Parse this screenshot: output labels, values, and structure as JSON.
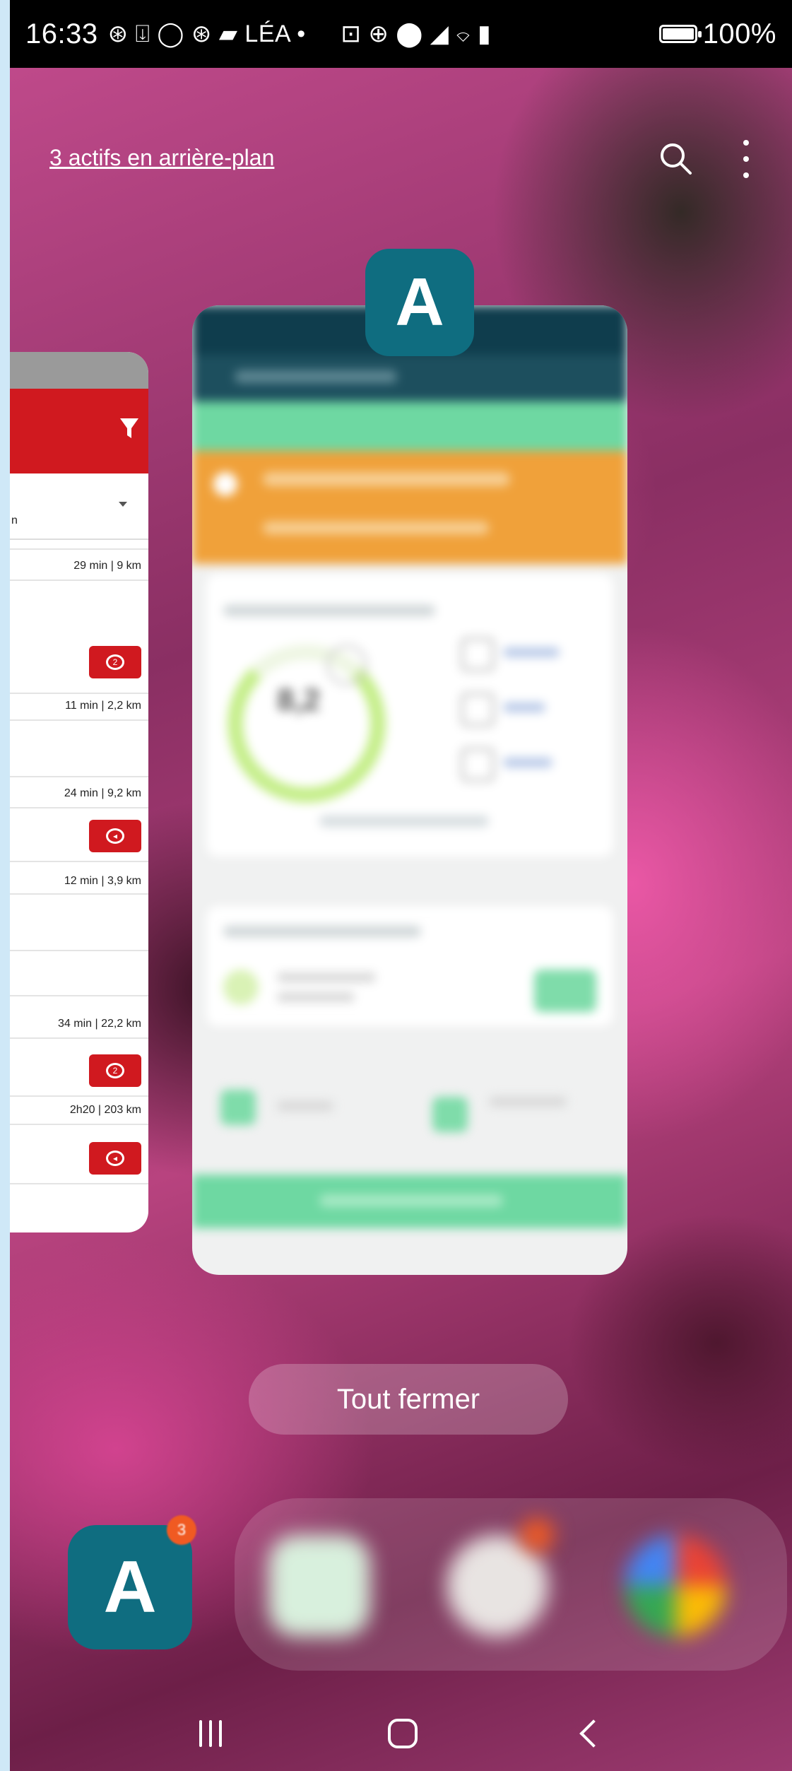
{
  "status_bar": {
    "time": "16:33",
    "notification_icons": "⊛ ⍗ ◯ ⊛ ▰ LÉA •",
    "system_icons": "⊡ ⊕ ⬤ ◢ ⌔ ▮",
    "battery": "100%",
    "battery_level": 1.0
  },
  "recents": {
    "background_apps_label": "3 actifs en arrière-plan",
    "close_all_label": "Tout fermer",
    "app_icon_letter": "A"
  },
  "left_card": {
    "rows": [
      {
        "info": "29 min | 9 km"
      },
      {
        "badge": "2"
      },
      {
        "info": "11 min | 2,2 km"
      },
      {
        "info": "24 min | 9,2 km"
      },
      {
        "info": "12 min | 3,9 km"
      },
      {
        "info": "34 min | 22,2 km"
      },
      {
        "badge": "2"
      },
      {
        "info": "2h20 | 203 km"
      }
    ],
    "stub_text": "n"
  },
  "main_card": {
    "score": "8,2"
  },
  "dock": {
    "app_letter": "A",
    "badge_count": "3"
  },
  "colors": {
    "app_teal": "#0f6d80",
    "card_red": "#d0191f",
    "banner_green": "#6ed8a2",
    "banner_orange": "#f0a13a",
    "badge_orange": "#f05a22"
  }
}
